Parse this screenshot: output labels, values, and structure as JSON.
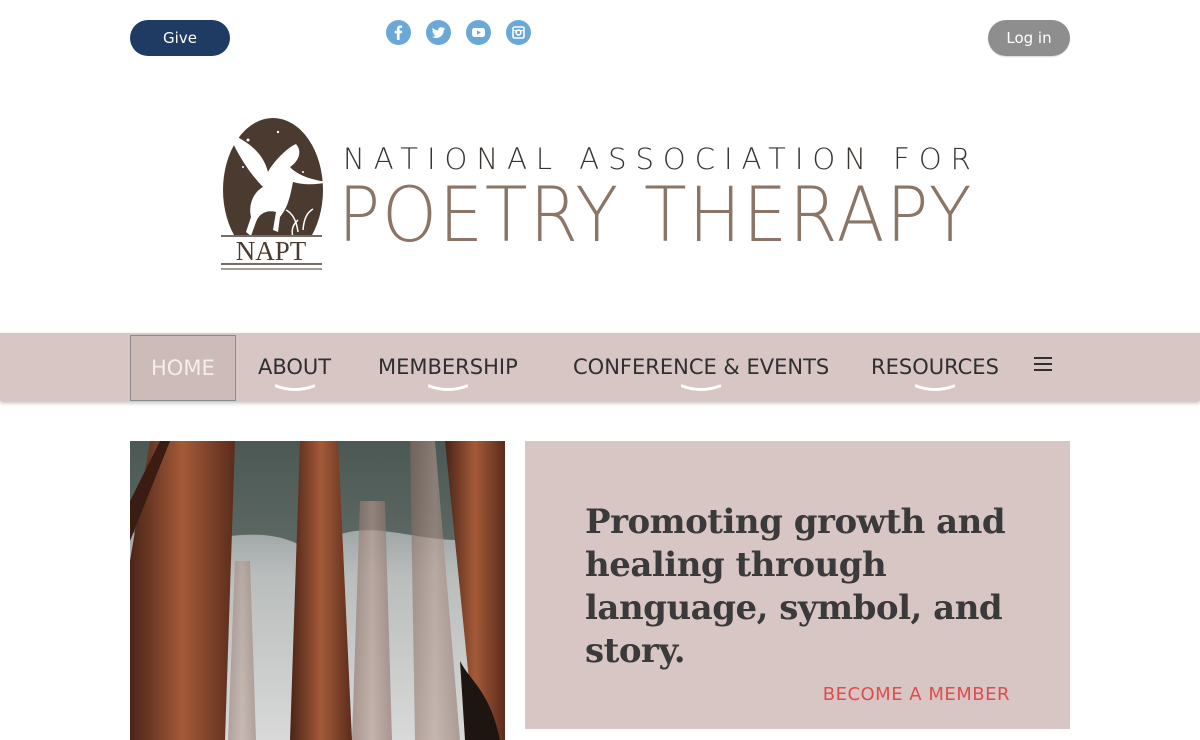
{
  "topbar": {
    "give_label": "Give",
    "login_label": "Log in",
    "social": [
      "facebook-icon",
      "twitter-icon",
      "youtube-icon",
      "instagram-icon"
    ]
  },
  "logo": {
    "monogram": "NAPT",
    "line1": "NATIONAL ASSOCIATION FOR",
    "line2": "POETRY THERAPY"
  },
  "nav": {
    "items": [
      {
        "label": "HOME",
        "active": true
      },
      {
        "label": "ABOUT"
      },
      {
        "label": "MEMBERSHIP"
      },
      {
        "label": "CONFERENCE & EVENTS"
      },
      {
        "label": "RESOURCES"
      }
    ],
    "menu_icon": "hamburger-menu-icon"
  },
  "hero": {
    "tagline": "Promoting growth and healing through language, symbol, and story.",
    "cta_label": "BECOME A MEMBER"
  },
  "colors": {
    "give_button": "#1f3a63",
    "login_button": "#8e8e8e",
    "nav_background": "#d8c6c4",
    "cta": "#e04c4c",
    "social_icon": "#6aa8d8",
    "logo_brown": "#8a7566"
  }
}
